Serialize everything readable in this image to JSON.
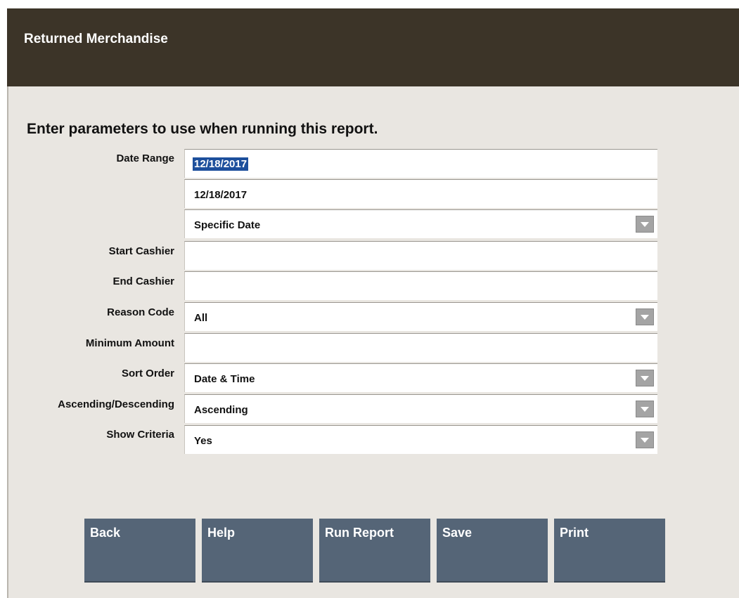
{
  "window": {
    "title": "Returned Merchandise"
  },
  "prompt": "Enter parameters to use when running this report.",
  "labels": {
    "date_range": "Date Range",
    "start_cashier": "Start Cashier",
    "end_cashier": "End Cashier",
    "reason_code": "Reason Code",
    "minimum_amount": "Minimum Amount",
    "sort_order": "Sort Order",
    "asc_desc": "Ascending/Descending",
    "show_criteria": "Show Criteria"
  },
  "values": {
    "date_from": "12/18/2017",
    "date_to": "12/18/2017",
    "date_mode": "Specific Date",
    "start_cashier": "",
    "end_cashier": "",
    "reason_code": "All",
    "minimum_amount": "",
    "sort_order": "Date & Time",
    "asc_desc": "Ascending",
    "show_criteria": "Yes"
  },
  "buttons": {
    "back": "Back",
    "help": "Help",
    "run_report": "Run Report",
    "save": "Save",
    "print": "Print"
  },
  "icons": {
    "dropdown": "chevron-down-icon"
  },
  "colors": {
    "titlebar": "#3c3428",
    "background": "#e9e6e1",
    "button": "#556577",
    "selection": "#1d4f9c"
  }
}
